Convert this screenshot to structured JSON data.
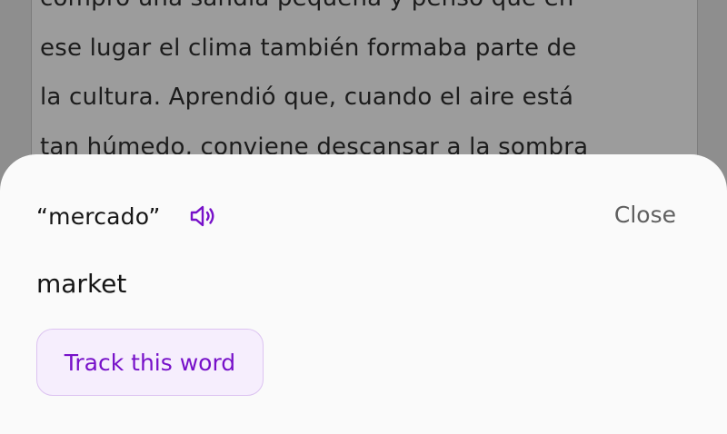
{
  "reader": {
    "lines": [
      "compró una sandía pequeña y pensó que en",
      "ese lugar el clima también formaba parte de",
      "la cultura.  Aprendió que, cuando el aire está",
      "tan húmedo, conviene descansar a la sombra"
    ]
  },
  "sheet": {
    "word": "“mercado”",
    "speaker_icon": "speaker-icon",
    "close_label": "Close",
    "translation": "market",
    "track_label": "Track this word",
    "accent_color": "#7711c9"
  }
}
